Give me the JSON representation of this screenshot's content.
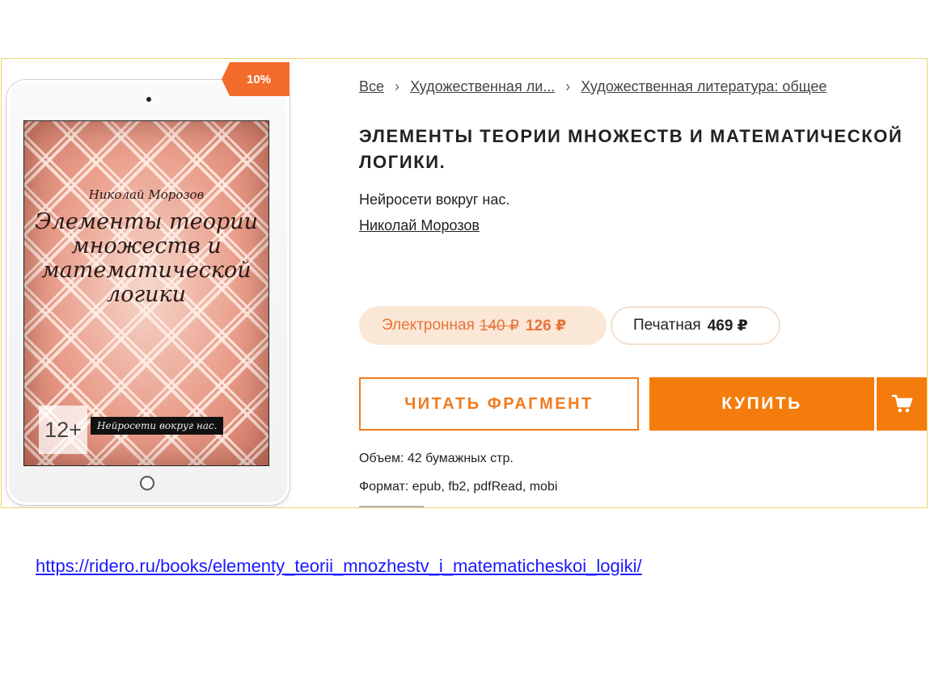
{
  "discount_badge": "10%",
  "cover": {
    "author": "Николай Морозов",
    "title": "Элементы теории множеств и математической логики",
    "age_rating": "12+",
    "series": "Нейросети вокруг нас."
  },
  "breadcrumb": {
    "items": [
      "Все",
      "Художественная ли...",
      "Художественная литература: общее"
    ],
    "separator": "›"
  },
  "book": {
    "title": "Элементы теории множеств и математической логики.",
    "series": "Нейросети вокруг нас.",
    "author": "Николай Морозов"
  },
  "formats": {
    "ebook": {
      "label": "Электронная",
      "old_price": "140 ₽",
      "price": "126 ₽"
    },
    "print": {
      "label": "Печатная",
      "price": "469 ₽"
    }
  },
  "actions": {
    "read_fragment": "Читать фрагмент",
    "buy": "Купить"
  },
  "details": {
    "volume": "Объем: 42 бумажных стр.",
    "format": "Формат: epub, fb2, pdfRead, mobi"
  },
  "source_link": "https://ridero.ru/books/elementy_teorii_mnozhestv_i_matematicheskoi_logiki/",
  "colors": {
    "accent": "#f47c0c",
    "badge": "#f36b2b",
    "ebook_pill_bg": "#fbe7d6",
    "ebook_pill_text": "#e8743a",
    "link": "#1a1aff"
  },
  "icons": {
    "cart": "cart-icon"
  }
}
